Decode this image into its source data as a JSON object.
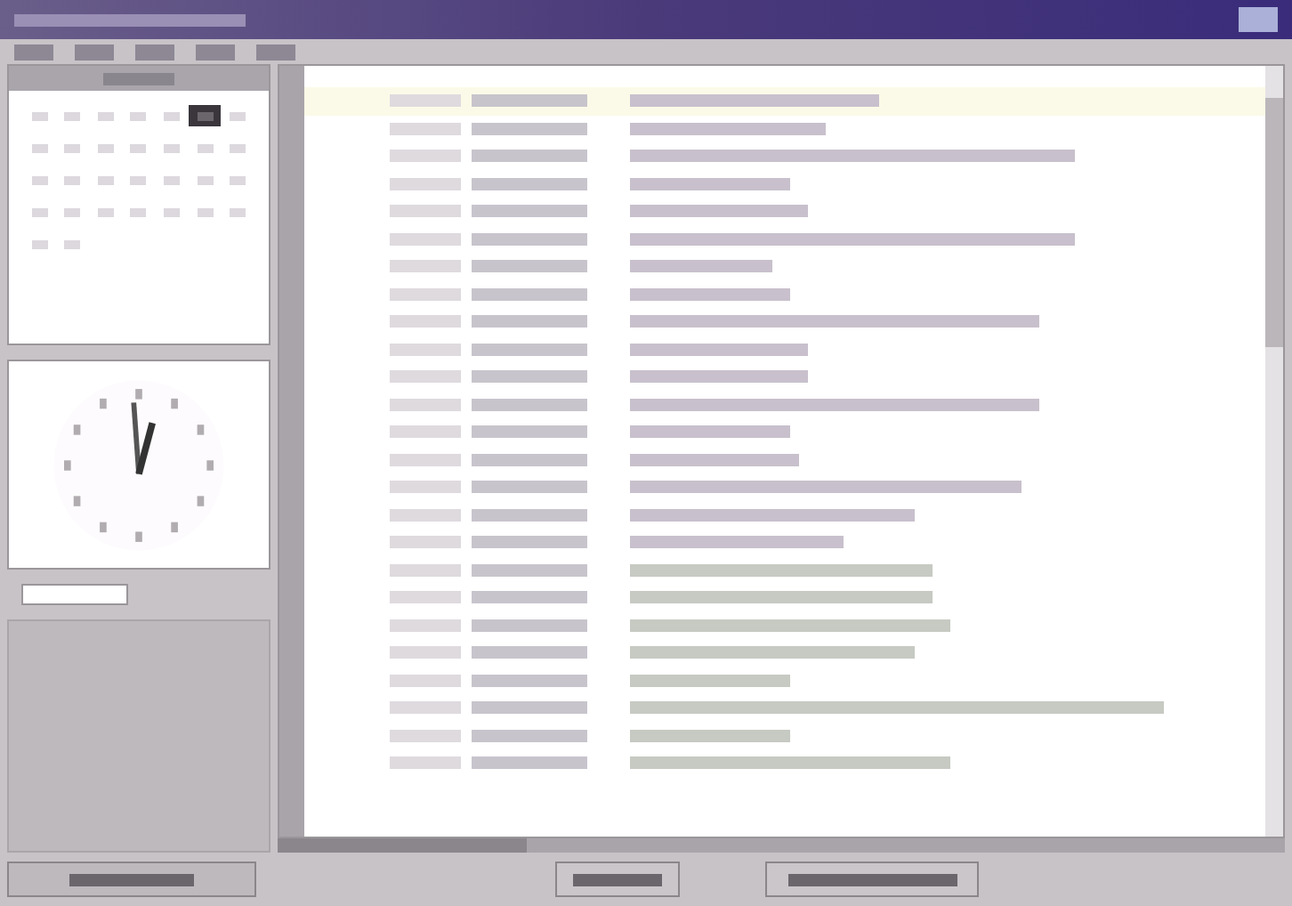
{
  "menu": [
    {
      "selected": false
    },
    {
      "selected": false
    },
    {
      "selected": false
    },
    {
      "selected": false
    },
    {
      "selected": false
    }
  ],
  "calendar": {
    "days": [
      {
        "selected": false
      },
      {
        "selected": false
      },
      {
        "selected": false
      },
      {
        "selected": false
      },
      {
        "selected": false
      },
      {
        "selected": true
      },
      {
        "selected": false
      },
      {
        "selected": false
      },
      {
        "selected": false
      },
      {
        "selected": false
      },
      {
        "selected": false
      },
      {
        "selected": false
      },
      {
        "selected": false
      },
      {
        "selected": false
      },
      {
        "selected": false
      },
      {
        "selected": false
      },
      {
        "selected": false
      },
      {
        "selected": false
      },
      {
        "selected": false
      },
      {
        "selected": false
      },
      {
        "selected": false
      },
      {
        "selected": false
      },
      {
        "selected": false
      },
      {
        "selected": false
      },
      {
        "selected": false
      },
      {
        "selected": false
      },
      {
        "selected": false
      },
      {
        "selected": false
      },
      {
        "selected": false
      },
      {
        "selected": false
      }
    ]
  },
  "rows": [
    {
      "selected": true
    },
    {
      "selected": false
    },
    {
      "selected": false
    },
    {
      "selected": false
    },
    {
      "selected": false
    },
    {
      "selected": false
    },
    {
      "selected": false
    },
    {
      "selected": false
    },
    {
      "selected": false
    },
    {
      "selected": false
    },
    {
      "selected": false
    },
    {
      "selected": false
    },
    {
      "selected": false
    },
    {
      "selected": false
    },
    {
      "selected": false
    },
    {
      "selected": false
    },
    {
      "selected": false
    },
    {
      "selected": false
    },
    {
      "selected": false
    },
    {
      "selected": false
    },
    {
      "selected": false
    },
    {
      "selected": false
    },
    {
      "selected": false
    },
    {
      "selected": false
    },
    {
      "selected": false
    }
  ],
  "buttons": [
    {
      "kind": "left"
    },
    {
      "kind": "status"
    },
    {
      "kind": "status"
    }
  ]
}
